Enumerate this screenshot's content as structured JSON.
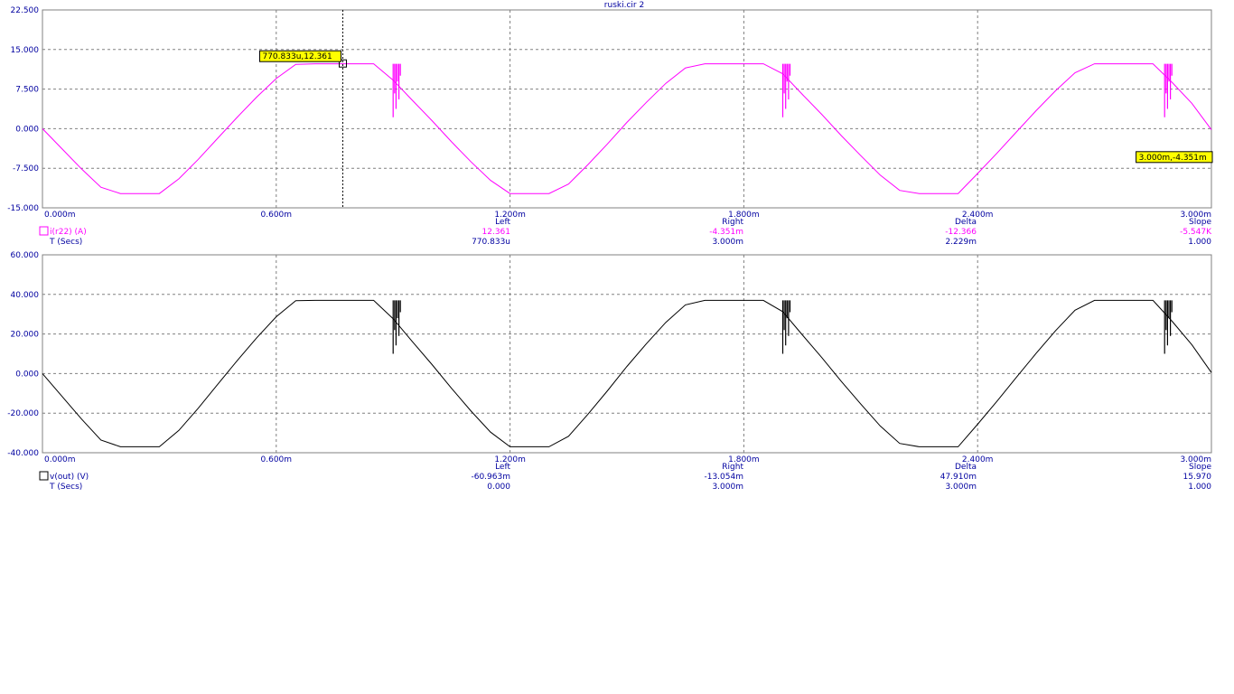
{
  "window": {
    "title": "ruski.cir 2"
  },
  "chart_data": [
    {
      "type": "line",
      "name": "upper-plot",
      "series": [
        {
          "name": "i(r22) (A)",
          "color": "#ff00ff",
          "x": [
            0,
            0.05,
            0.1,
            0.15,
            0.2,
            0.25,
            0.3,
            0.35,
            0.4,
            0.45,
            0.5,
            0.55,
            0.6,
            0.65,
            0.7,
            0.75,
            0.8,
            0.85,
            0.9,
            0.95,
            1.0,
            1.05,
            1.1,
            1.15,
            1.2,
            1.25,
            1.3,
            1.35,
            1.4,
            1.45,
            1.5,
            1.55,
            1.6,
            1.65,
            1.7,
            1.75,
            1.8,
            1.85,
            1.9,
            1.95,
            2.0,
            2.05,
            2.1,
            2.15,
            2.2,
            2.25,
            2.3,
            2.35,
            2.4,
            2.45,
            2.5,
            2.55,
            2.6,
            2.65,
            2.7,
            2.75,
            2.8,
            2.85,
            2.9,
            2.95,
            3.0
          ],
          "y": [
            0,
            -3.8,
            -7.6,
            -11.1,
            -12.3,
            -12.3,
            -12.3,
            -9.5,
            -5.8,
            -1.8,
            2.2,
            6.0,
            9.5,
            12.2,
            12.3,
            12.3,
            12.3,
            12.3,
            9.2,
            5.3,
            1.5,
            -2.5,
            -6.3,
            -9.8,
            -12.3,
            -12.3,
            -12.3,
            -10.5,
            -6.8,
            -2.9,
            1.2,
            5.0,
            8.6,
            11.5,
            12.3,
            12.3,
            12.3,
            12.3,
            10.4,
            6.5,
            2.7,
            -1.3,
            -5.1,
            -8.8,
            -11.7,
            -12.3,
            -12.3,
            -12.3,
            -8.5,
            -4.6,
            -0.6,
            3.4,
            7.2,
            10.6,
            12.3,
            12.3,
            12.3,
            12.3,
            8.7,
            4.8,
            -0.2
          ],
          "oscillation_bursts_ms": [
            0.9,
            1.9,
            2.88
          ]
        }
      ],
      "xlim": [
        0,
        3.0
      ],
      "ylim": [
        -15.0,
        22.5
      ],
      "x_ticks": [
        "0.000m",
        "0.600m",
        "1.200m",
        "1.800m",
        "2.400m",
        "3.000m"
      ],
      "y_ticks": [
        "22.500",
        "15.000",
        "7.500",
        "0.000",
        "-7.500",
        "-15.000"
      ],
      "grid": true,
      "cursors": [
        {
          "x": 0.770833,
          "y": 12.361,
          "label": "770.833u,12.361"
        },
        {
          "x": 3.0,
          "y": -4.351,
          "label": "3.000m,-4.351m"
        }
      ],
      "readout": {
        "headers": [
          "Left",
          "Right",
          "Delta",
          "Slope"
        ],
        "rows": [
          {
            "name": "i(r22) (A)",
            "values": [
              "12.361",
              "-4.351m",
              "-12.366",
              "-5.547K"
            ]
          },
          {
            "name": "T (Secs)",
            "values": [
              "770.833u",
              "3.000m",
              "2.229m",
              "1.000"
            ]
          }
        ]
      }
    },
    {
      "type": "line",
      "name": "lower-plot",
      "series": [
        {
          "name": "v(out) (V)",
          "color": "#000000",
          "x": [
            0,
            0.05,
            0.1,
            0.15,
            0.2,
            0.25,
            0.3,
            0.35,
            0.4,
            0.45,
            0.5,
            0.55,
            0.6,
            0.65,
            0.7,
            0.75,
            0.8,
            0.85,
            0.9,
            0.95,
            1.0,
            1.05,
            1.1,
            1.15,
            1.2,
            1.25,
            1.3,
            1.35,
            1.4,
            1.45,
            1.5,
            1.55,
            1.6,
            1.65,
            1.7,
            1.75,
            1.8,
            1.85,
            1.9,
            1.95,
            2.0,
            2.05,
            2.1,
            2.15,
            2.2,
            2.25,
            2.3,
            2.35,
            2.4,
            2.45,
            2.5,
            2.55,
            2.6,
            2.65,
            2.7,
            2.75,
            2.8,
            2.85,
            2.9,
            2.95,
            3.0
          ],
          "y": [
            0,
            -11.5,
            -22.9,
            -33.6,
            -37.0,
            -37.0,
            -37.0,
            -28.7,
            -17.5,
            -5.4,
            6.6,
            18.1,
            28.7,
            36.8,
            37.0,
            37.0,
            37.0,
            37.0,
            27.7,
            16.0,
            4.5,
            -7.5,
            -19.0,
            -29.6,
            -37.0,
            -37.0,
            -37.0,
            -31.7,
            -20.5,
            -8.7,
            3.6,
            15.1,
            25.9,
            34.7,
            37.0,
            37.0,
            37.0,
            37.0,
            31.3,
            19.6,
            8.1,
            -3.9,
            -15.4,
            -26.5,
            -35.3,
            -37.0,
            -37.0,
            -37.0,
            -25.6,
            -13.9,
            -1.8,
            10.2,
            21.7,
            32.0,
            37.0,
            37.0,
            37.0,
            37.0,
            26.2,
            14.5,
            0.5
          ],
          "oscillation_bursts_ms": [
            0.9,
            1.9,
            2.88
          ]
        }
      ],
      "xlim": [
        0,
        3.0
      ],
      "ylim": [
        -40.0,
        60.0
      ],
      "x_ticks": [
        "0.000m",
        "0.600m",
        "1.200m",
        "1.800m",
        "2.400m",
        "3.000m"
      ],
      "y_ticks": [
        "60.000",
        "40.000",
        "20.000",
        "0.000",
        "-20.000",
        "-40.000"
      ],
      "grid": true,
      "readout": {
        "headers": [
          "Left",
          "Right",
          "Delta",
          "Slope"
        ],
        "rows": [
          {
            "name": "v(out) (V)",
            "values": [
              "-60.963m",
              "-13.054m",
              "47.910m",
              "15.970"
            ]
          },
          {
            "name": "T (Secs)",
            "values": [
              "0.000",
              "3.000m",
              "3.000m",
              "1.000"
            ]
          }
        ]
      }
    }
  ]
}
